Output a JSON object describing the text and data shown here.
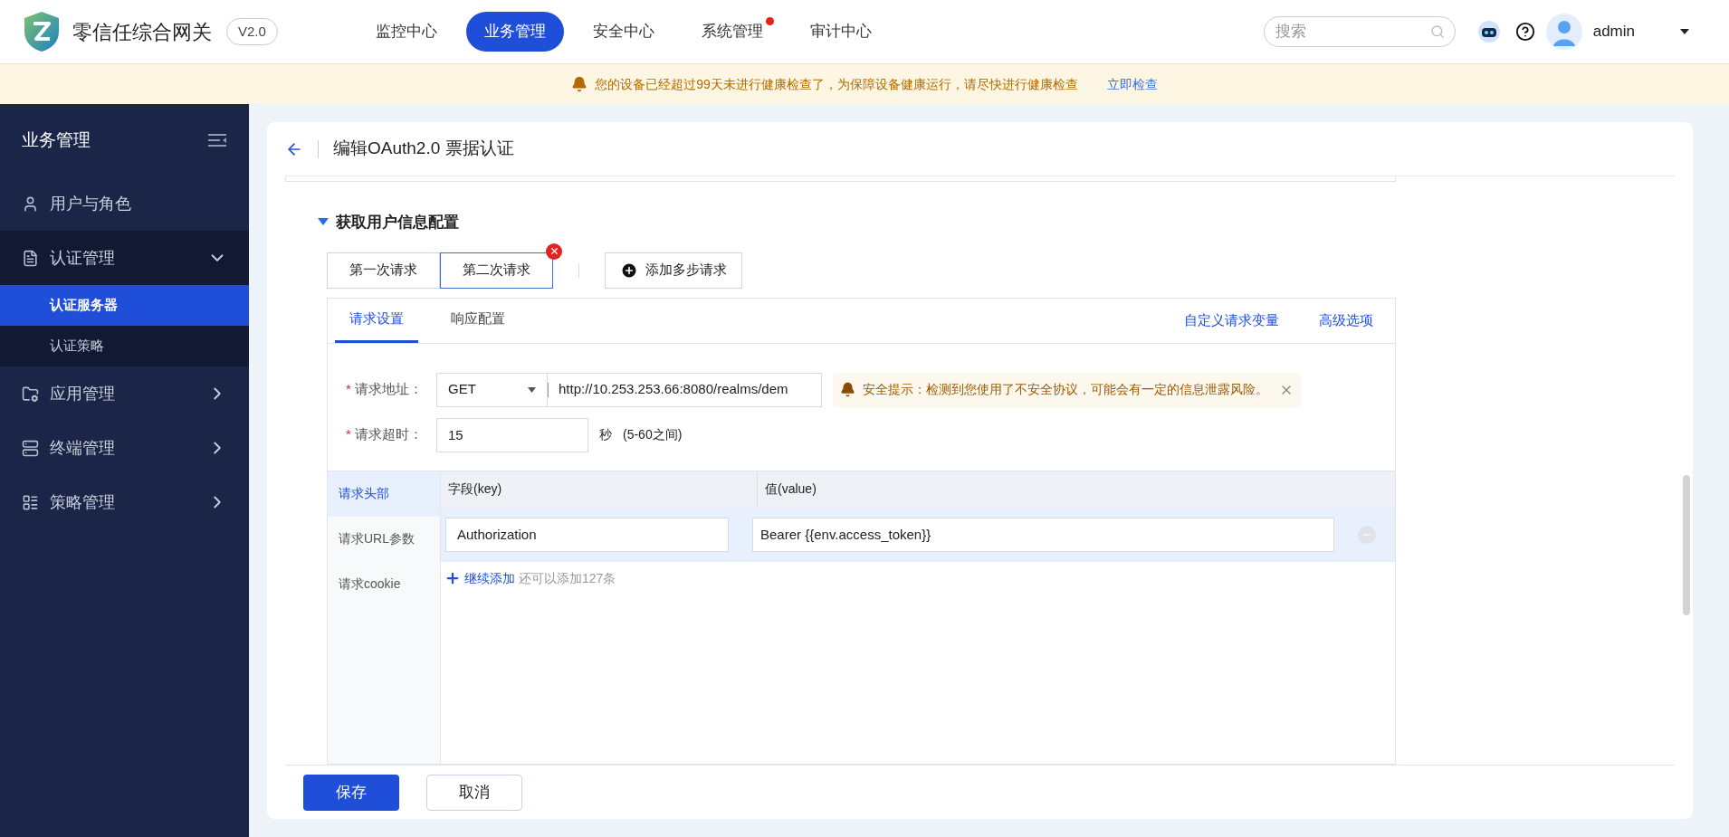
{
  "app": {
    "name": "零信任综合网关",
    "version": "V2.0"
  },
  "nav": [
    {
      "label": "监控中心",
      "selected": false,
      "alert": false
    },
    {
      "label": "业务管理",
      "selected": true,
      "alert": false
    },
    {
      "label": "安全中心",
      "selected": false,
      "alert": false
    },
    {
      "label": "系统管理",
      "selected": false,
      "alert": true
    },
    {
      "label": "审计中心",
      "selected": false,
      "alert": false
    }
  ],
  "header": {
    "search_placeholder": "搜索",
    "user": "admin"
  },
  "notice": {
    "text": "您的设备已经超过99天未进行健康检查了，为保障设备健康运行，请尽快进行健康检查",
    "link": "立即检查"
  },
  "sidebar": {
    "title": "业务管理",
    "items": [
      {
        "label": "用户与角色"
      },
      {
        "label": "认证管理",
        "expanded": true,
        "children": [
          {
            "label": "认证服务器",
            "selected": true
          },
          {
            "label": "认证策略",
            "selected": false
          }
        ]
      },
      {
        "label": "应用管理",
        "expanded": false
      },
      {
        "label": "终端管理",
        "expanded": false
      },
      {
        "label": "策略管理",
        "expanded": false
      }
    ]
  },
  "page": {
    "title": "编辑OAuth2.0 票据认证",
    "section": {
      "title": "获取用户信息配置",
      "expanded": true
    },
    "steps": [
      {
        "label": "第一次请求",
        "selected": false
      },
      {
        "label": "第二次请求",
        "selected": true
      }
    ],
    "add_step": "添加多步请求",
    "tabs": [
      {
        "label": "请求设置",
        "selected": true
      },
      {
        "label": "响应配置",
        "selected": false
      }
    ],
    "links": [
      "自定义请求变量",
      "高级选项"
    ],
    "url": {
      "label": "请求地址：",
      "required_mark": "*",
      "method": "GET",
      "value": "http://10.253.253.66:8080/realms/dem"
    },
    "warning": "安全提示：检测到您使用了不安全协议，可能会有一定的信息泄露风险。",
    "timeout": {
      "label": "请求超时：",
      "required_mark": "*",
      "value": "15",
      "unit": "秒",
      "hint": "(5-60之间)"
    },
    "param_tabs": [
      {
        "label": "请求头部",
        "selected": true
      },
      {
        "label": "请求URL参数",
        "selected": false
      },
      {
        "label": "请求cookie",
        "selected": false
      }
    ],
    "columns": [
      "字段(key)",
      "值(value)"
    ],
    "rows": [
      {
        "key": "Authorization",
        "value": "Bearer {{env.access_token}}"
      }
    ],
    "add_row": {
      "link": "继续添加",
      "note": "还可以添加127条"
    },
    "buttons": [
      {
        "label": "保存",
        "kind": "primary"
      },
      {
        "label": "取消",
        "kind": "default"
      }
    ]
  }
}
